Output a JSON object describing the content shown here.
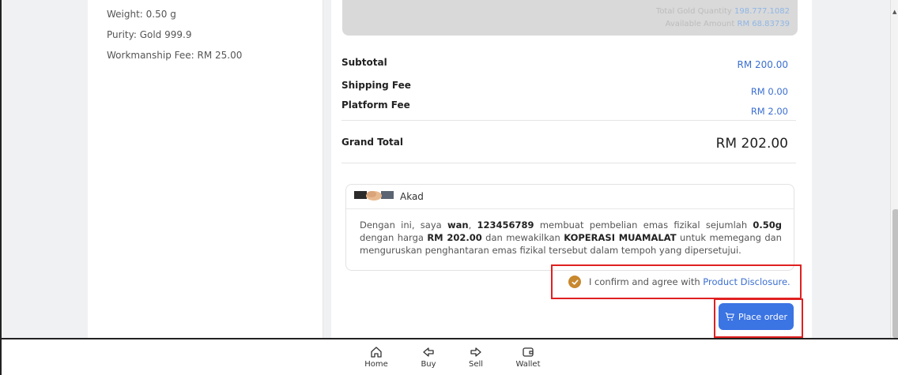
{
  "product": {
    "weight": "Weight: 0.50 g",
    "purity": "Purity: Gold 999.9",
    "workmanship": "Workmanship Fee: RM 25.00"
  },
  "summary_box": {
    "line1_label": "Total Gold Quantity",
    "line1_value": "198.777.1082",
    "line2_label": "Available Amount",
    "line2_value": "RM 68.83739"
  },
  "pricing": {
    "subtotal_label": "Subtotal",
    "subtotal_value": "RM 200.00",
    "shipping_label": "Shipping Fee",
    "shipping_value": "RM 0.00",
    "platform_label": "Platform Fee",
    "platform_value": "RM 2.00",
    "grand_label": "Grand Total",
    "grand_value": "RM 202.00"
  },
  "akad": {
    "title": "Akad",
    "t1": "Dengan ini, saya ",
    "name": "wan",
    "t2": ", ",
    "id": "123456789",
    "t3": " membuat pembelian emas fizikal sejumlah ",
    "qty": "0.50g",
    "t4": " dengan harga ",
    "price": "RM 202.00",
    "t5": " dan mewakilkan ",
    "org": "KOPERASI MUAMALAT",
    "t6": " untuk memegang dan menguruskan penghantaran emas fizikal tersebut dalam tempoh yang dipersetujui."
  },
  "confirm": {
    "text": "I confirm and agree with ",
    "link": "Product Disclosure."
  },
  "order_button": {
    "label": "Place order",
    "icon": "cart-icon"
  },
  "bottom_nav": [
    {
      "label": "Home",
      "icon": "home-icon"
    },
    {
      "label": "Buy",
      "icon": "buy-arrow-icon"
    },
    {
      "label": "Sell",
      "icon": "sell-arrow-icon"
    },
    {
      "label": "Wallet",
      "icon": "wallet-icon"
    }
  ],
  "colors": {
    "accent": "#3b74e3",
    "link": "#3b6fd0",
    "check": "#c8882e",
    "highlight_border": "#e02020"
  }
}
